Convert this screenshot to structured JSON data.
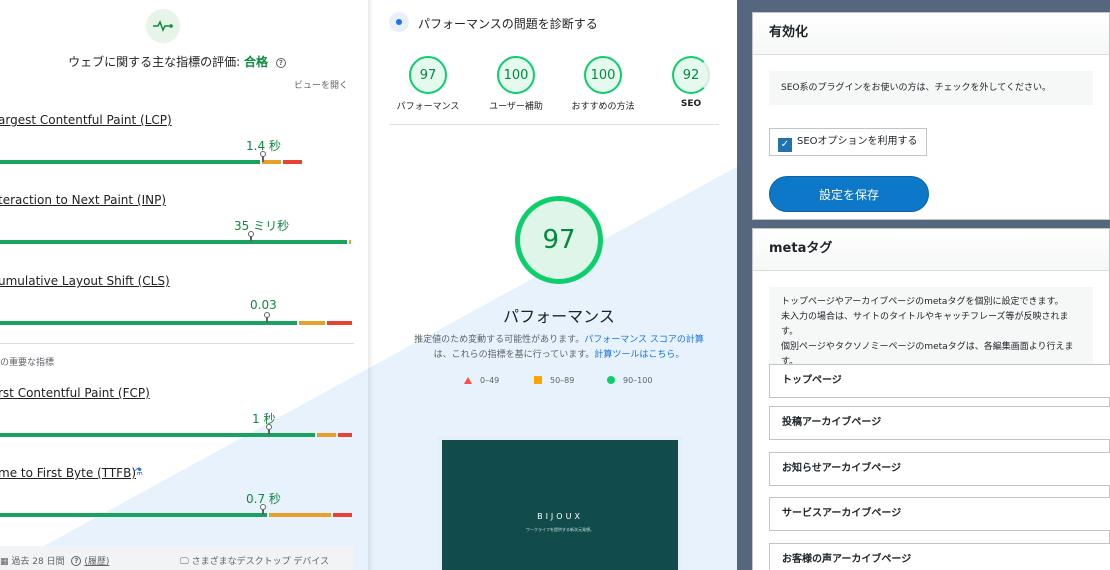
{
  "crux": {
    "assessment_label": "ウェブに関する主な指標の評価:",
    "assessment_value": "合格",
    "view_open": "ビューを開く",
    "metrics": [
      {
        "name": "argest Contentful Paint (LCP)",
        "value": "1.4 秒",
        "segments": [
          0.74,
          0.06,
          0.06
        ]
      },
      {
        "name": "teraction to Next Paint (INP)",
        "value": "35 ミリ秒",
        "segments": [
          0.985,
          0.01,
          0.005
        ]
      },
      {
        "name": "umulative Layout Shift (CLS)",
        "value": "0.03",
        "segments": [
          0.845,
          0.08,
          0.075
        ]
      }
    ],
    "other_title": "の重要な指標",
    "other_metrics": [
      {
        "name": "rst Contentful Paint (FCP)",
        "value": "1 秒",
        "segments": [
          0.895,
          0.06,
          0.045
        ]
      },
      {
        "name": "me to First Byte (TTFB)",
        "value": "0.7 秒",
        "segments": [
          0.76,
          0.18,
          0.06
        ]
      }
    ],
    "footer": {
      "period": "過去 28 日間",
      "history": "(履歴)",
      "devices": "さまざまなデスクトップ デバイス"
    }
  },
  "lighthouse": {
    "title": "パフォーマンスの問題を診断する",
    "scores": [
      {
        "label": "パフォーマンス",
        "value": "97"
      },
      {
        "label": "ユーザー補助",
        "value": "100"
      },
      {
        "label": "おすすめの方法",
        "value": "100"
      },
      {
        "label": "SEO",
        "value": "92"
      }
    ],
    "main_score": "97",
    "main_label": "パフォーマンス",
    "estimate_text": "推定値のため変動する可能性があります。",
    "estimate_link1": "パフォーマンス スコアの計算",
    "estimate_text2": "は、これらの指標を基に行っています。",
    "estimate_link2": "計算ツールはこちら。",
    "legend": [
      {
        "range": "0–49",
        "color": "#ff4e42"
      },
      {
        "range": "50–89",
        "color": "#ffa400"
      },
      {
        "range": "90–100",
        "color": "#0cce6b"
      }
    ],
    "screenshot": {
      "brand": "BIJOUX",
      "tagline": "ワークライフを提供する新次元発想。"
    }
  },
  "settings": {
    "enable_title": "有効化",
    "enable_notice": "SEO系のプラグインをお使いの方は、チェックを外してください。",
    "checkbox_label": "SEOオプションを利用する",
    "checkbox_checked": true,
    "save_label": "設定を保存",
    "meta_title": "metaタグ",
    "meta_notice": [
      "トップページやアーカイブページのmetaタグを個別に設定できます。",
      "未入力の場合は、サイトのタイトルやキャッチフレーズ等が反映されます。",
      "個別ページやタクソノミーページのmetaタグは、各編集画面より行えます。"
    ],
    "meta_items": [
      "トップページ",
      "投稿アーカイブページ",
      "お知らせアーカイブページ",
      "サービスアーカイブページ",
      "お客様の声アーカイブページ"
    ]
  }
}
